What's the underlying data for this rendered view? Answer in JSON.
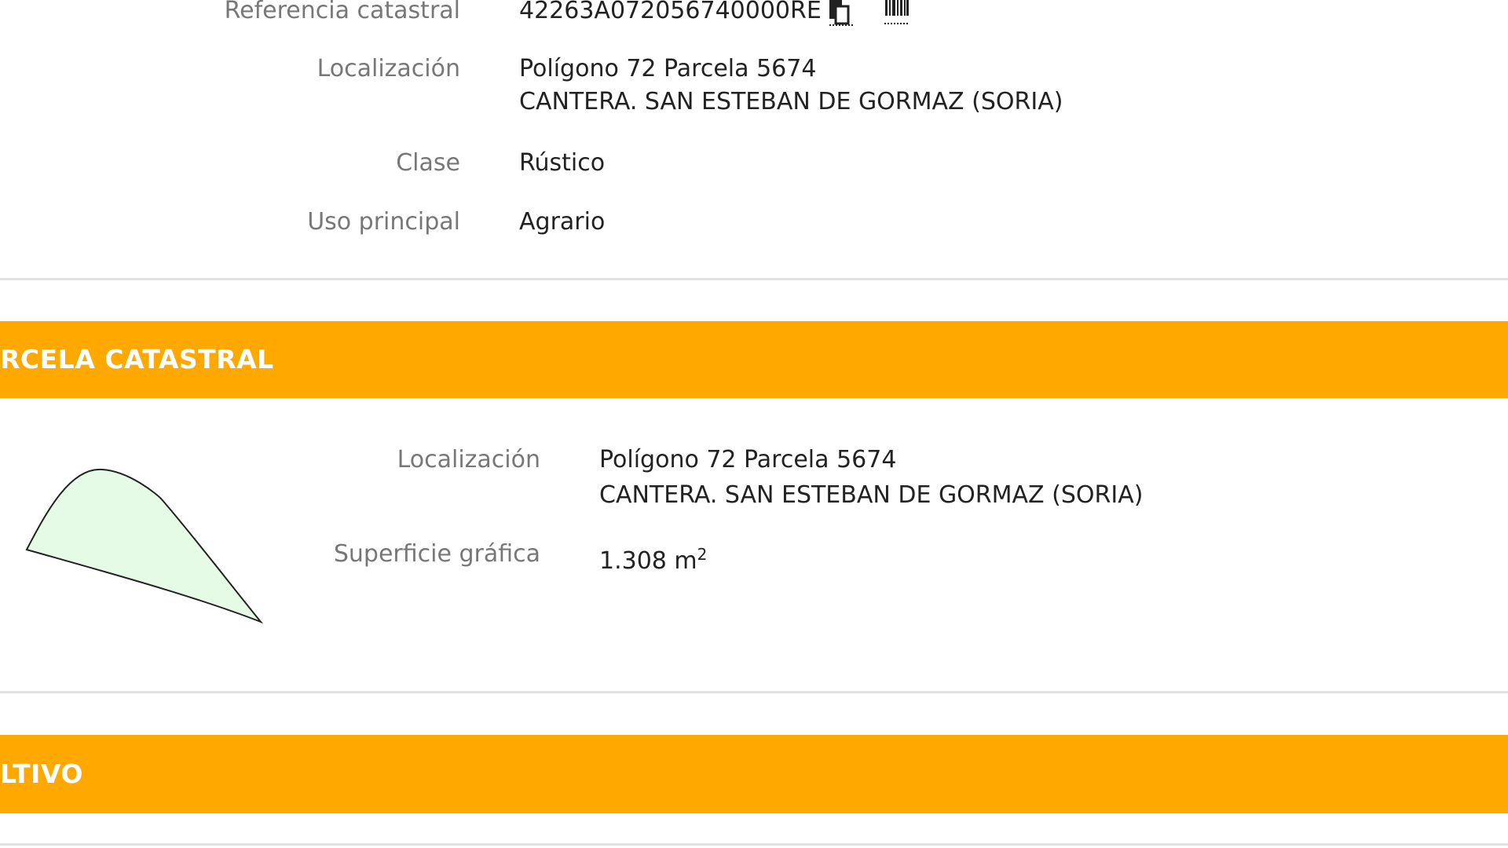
{
  "summary": {
    "ref_label": "Referencia catastral",
    "ref_value": "42263A072056740000RE",
    "copy_icon": "copy-icon",
    "barcode_icon": "barcode-icon",
    "loc_label": "Localización",
    "loc_line1": "Polígono 72 Parcela 5674",
    "loc_line2": "CANTERA. SAN ESTEBAN DE GORMAZ (SORIA)",
    "clase_label": "Clase",
    "clase_value": "Rústico",
    "uso_label": "Uso principal",
    "uso_value": "Agrario"
  },
  "parcela": {
    "title": "RCELA CATASTRAL",
    "band_color": "#ffa800",
    "loc_label": "Localización",
    "loc_line1": "Polígono 72 Parcela 5674",
    "loc_line2": "CANTERA. SAN ESTEBAN DE GORMAZ (SORIA)",
    "sup_label": "Superficie gráfica",
    "sup_value": "1.308 m",
    "sup_exp": "2"
  },
  "cultivo": {
    "title": "LTIVO"
  }
}
